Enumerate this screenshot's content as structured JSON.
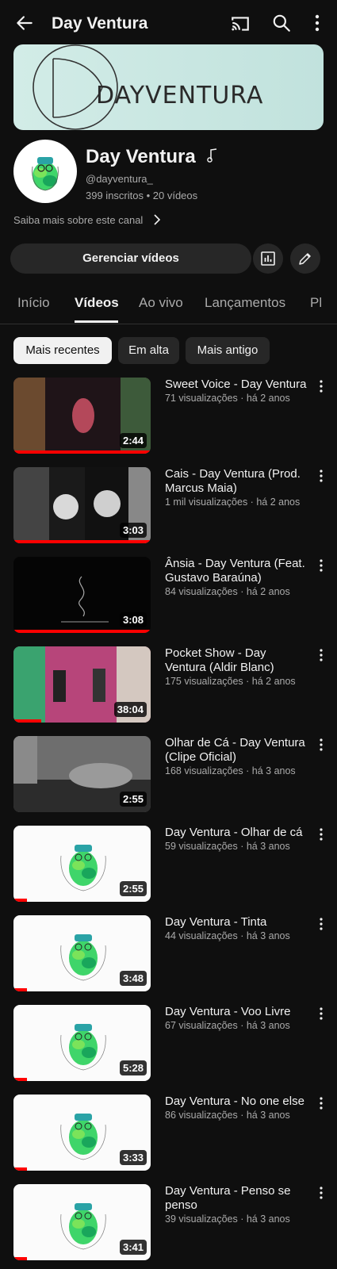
{
  "header": {
    "title": "Day Ventura"
  },
  "banner": {
    "text": "DAYVENTURA"
  },
  "channel": {
    "name": "Day Ventura",
    "handle": "@dayventura_",
    "stats": "399 inscritos • 20 vídeos",
    "about": "Saiba mais sobre este canal"
  },
  "actions": {
    "manage_label": "Gerenciar vídeos"
  },
  "tabs": [
    "Início",
    "Vídeos",
    "Ao vivo",
    "Lançamentos",
    "Pl"
  ],
  "chips": [
    "Mais recentes",
    "Em alta",
    "Mais antigo"
  ],
  "videos": [
    {
      "title": "Sweet Voice - Day Ventura",
      "meta": "71 visualizações · há 2 anos",
      "duration": "2:44",
      "progress": 1.0
    },
    {
      "title": "Cais - Day Ventura (Prod. Marcus Maia)",
      "meta": "1 mil visualizações · há 2 anos",
      "duration": "3:03",
      "progress": 1.0
    },
    {
      "title": "Ânsia - Day Ventura (Feat. Gustavo Baraúna)",
      "meta": "84 visualizações · há 2 anos",
      "duration": "3:08",
      "progress": 1.0
    },
    {
      "title": "Pocket Show - Day Ventura (Aldir Blanc)",
      "meta": "175 visualizações · há 2 anos",
      "duration": "38:04",
      "progress": 0.2
    },
    {
      "title": "Olhar de Cá - Day Ventura (Clipe Oficial)",
      "meta": "168 visualizações · há 3 anos",
      "duration": "2:55",
      "progress": 0.0
    },
    {
      "title": "Day Ventura - Olhar de cá",
      "meta": "59 visualizações · há 3 anos",
      "duration": "2:55",
      "progress": 0.1
    },
    {
      "title": "Day Ventura - Tinta",
      "meta": "44 visualizações · há 3 anos",
      "duration": "3:48",
      "progress": 0.1
    },
    {
      "title": "Day Ventura - Voo Livre",
      "meta": "67 visualizações · há 3 anos",
      "duration": "5:28",
      "progress": 0.1
    },
    {
      "title": "Day Ventura - No one else",
      "meta": "86 visualizações · há 3 anos",
      "duration": "3:33",
      "progress": 0.1
    },
    {
      "title": "Day Ventura - Penso se penso",
      "meta": "39 visualizações · há 3 anos",
      "duration": "3:41",
      "progress": 0.1
    }
  ]
}
